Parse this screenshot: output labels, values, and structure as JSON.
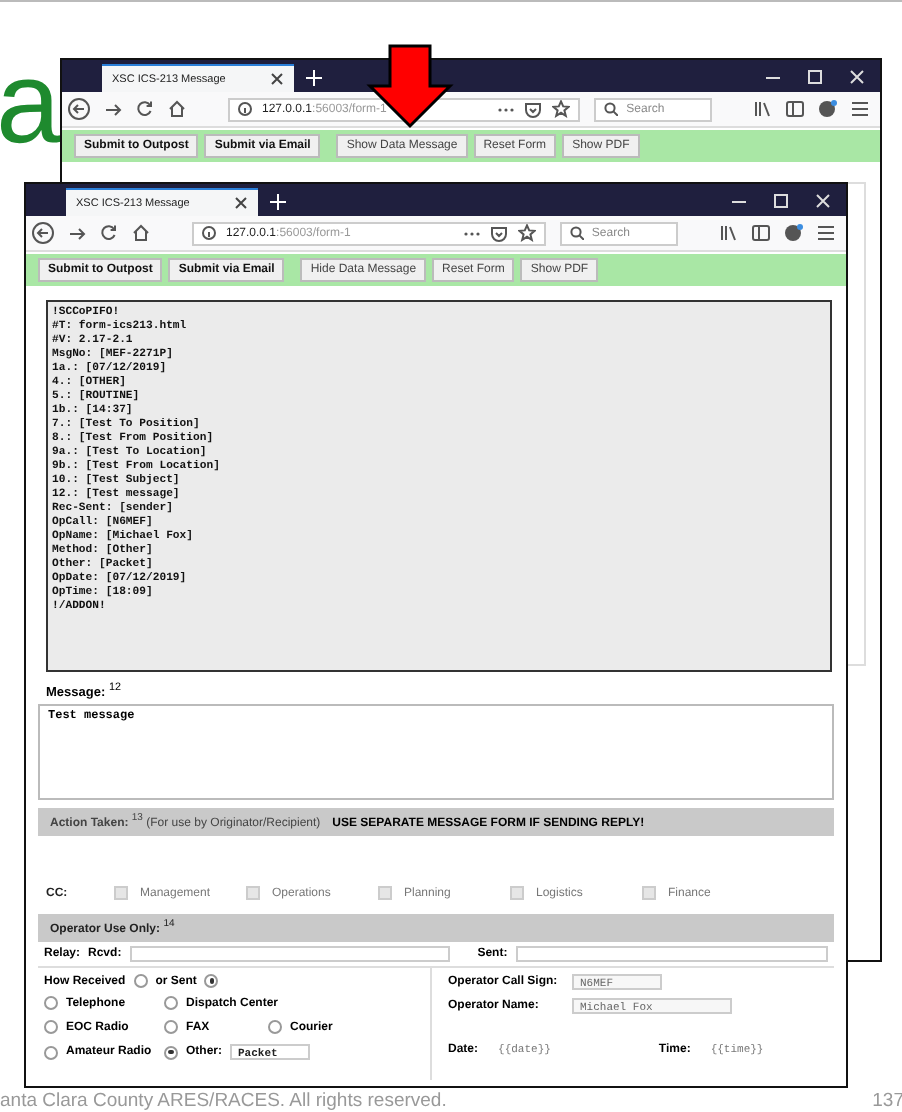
{
  "slide": {
    "heading_fragment": "a",
    "footer": "anta Clara County ARES/RACES.  All rights reserved.",
    "page_number": "137"
  },
  "windows": [
    {
      "tab_title": "XSC ICS-213 Message",
      "url_host": "127.0.0.1",
      "url_path": ":56003/form-1",
      "search_placeholder": "Search",
      "toolbar": [
        {
          "label": "Submit to Outpost",
          "primary": true
        },
        {
          "label": "Submit via Email",
          "primary": true
        },
        {
          "label": "Show Data Message",
          "primary": false
        },
        {
          "label": "Reset Form",
          "primary": false
        },
        {
          "label": "Show PDF",
          "primary": false
        }
      ]
    },
    {
      "tab_title": "XSC ICS-213 Message",
      "url_host": "127.0.0.1",
      "url_path": ":56003/form-1",
      "search_placeholder": "Search",
      "toolbar": [
        {
          "label": "Submit to Outpost",
          "primary": true
        },
        {
          "label": "Submit via Email",
          "primary": true
        },
        {
          "label": "Hide Data Message",
          "primary": false
        },
        {
          "label": "Reset Form",
          "primary": false
        },
        {
          "label": "Show PDF",
          "primary": false
        }
      ],
      "form": {
        "data_message": "!SCCoPIFO!\n#T: form-ics213.html\n#V: 2.17-2.1\nMsgNo: [MEF-2271P]\n1a.: [07/12/2019]\n4.: [OTHER]\n5.: [ROUTINE]\n1b.: [14:37]\n7.: [Test To Position]\n8.: [Test From Position]\n9a.: [Test To Location]\n9b.: [Test From Location]\n10.: [Test Subject]\n12.: [Test message]\nRec-Sent: [sender]\nOpCall: [N6MEF]\nOpName: [Michael Fox]\nMethod: [Other]\nOther: [Packet]\nOpDate: [07/12/2019]\nOpTime: [18:09]\n!/ADDON!",
        "message": {
          "label": "**Message:** $^{12}$",
          "value": "Test message"
        },
        "action_taken": {
          "label": "**Action Taken:** $^{13}$ (For use by Originator/Recipient)",
          "warning": "USE SEPARATE MESSAGE FORM IF SENDING REPLY!"
        },
        "cc": {
          "label": "CC:",
          "options": [
            {
              "label": "Management",
              "checked": false
            },
            {
              "label": "Operations",
              "checked": false
            },
            {
              "label": "Planning",
              "checked": false
            },
            {
              "label": "Logistics",
              "checked": false
            },
            {
              "label": "Finance",
              "checked": false
            }
          ]
        },
        "operator_use": {
          "label": "**Operator Use Only:** $^{14}$"
        },
        "relay": {
          "label": "Relay:",
          "rcvd_label": "Rcvd:",
          "sent_label": "Sent:"
        },
        "direction": [
          {
            "label": "How Received",
            "selected": false
          },
          {
            "label": "or Sent",
            "selected": true
          }
        ],
        "methods": [
          {
            "label": "Telephone",
            "selected": false
          },
          {
            "label": "Dispatch Center",
            "selected": false
          },
          {
            "label": "EOC Radio",
            "selected": false
          },
          {
            "label": "FAX",
            "selected": false
          },
          {
            "label": "Courier",
            "selected": false
          },
          {
            "label": "Amateur Radio",
            "selected": false
          },
          {
            "label": "Other:",
            "selected": true,
            "value": "Packet"
          }
        ],
        "call_sign": {
          "label": "Operator Call Sign:",
          "value": "N6MEF"
        },
        "operator_name": {
          "label": "Operator Name:",
          "value": "Michael Fox"
        },
        "date": {
          "label": "Date:",
          "value": "{{date}}"
        },
        "time": {
          "label": "Time:",
          "value": "{{time}}"
        }
      }
    }
  ]
}
